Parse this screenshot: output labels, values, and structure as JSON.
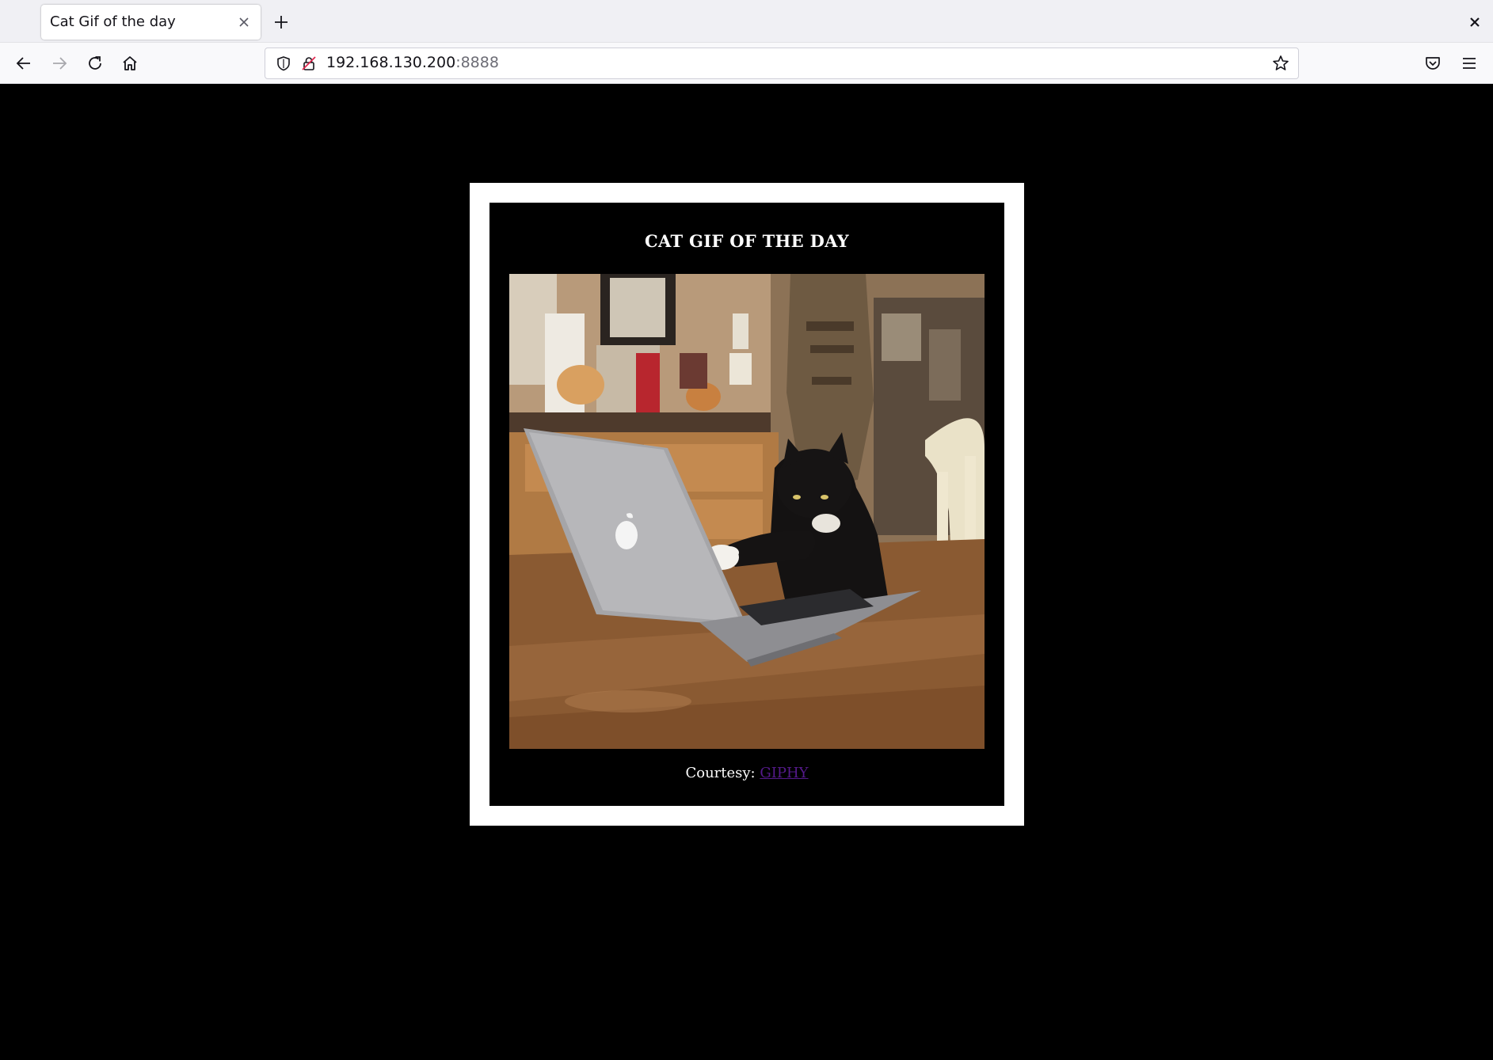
{
  "browser": {
    "tab_title": "Cat Gif of the day",
    "url_host": "192.168.130.200",
    "url_port": ":8888"
  },
  "page": {
    "heading": "CAT GIF OF THE DAY",
    "courtesy_label": "Courtesy:",
    "courtesy_link": "GIPHY"
  },
  "colors": {
    "page_background": "#000000",
    "frame_border": "#ffffff",
    "visited_link": "#551a8b"
  }
}
